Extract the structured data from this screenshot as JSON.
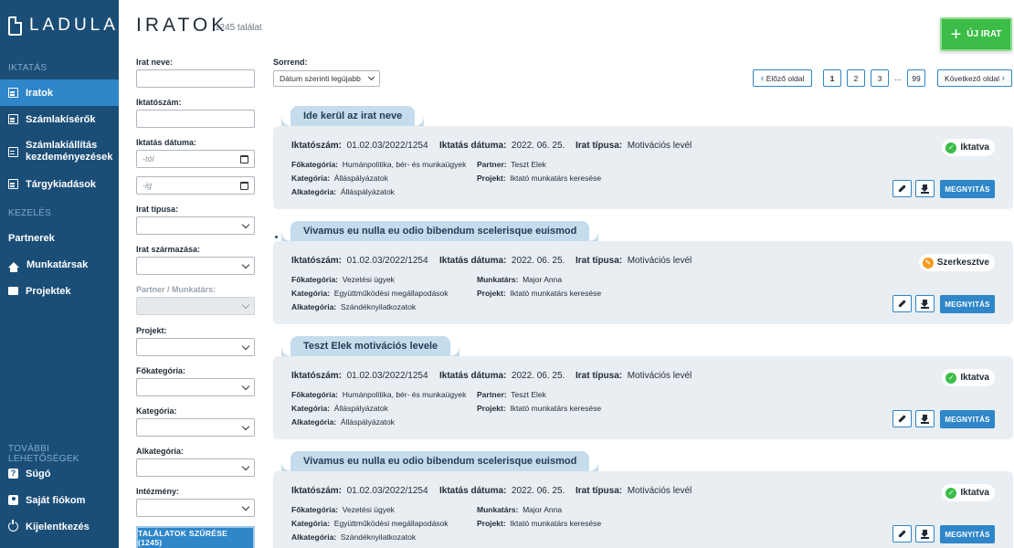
{
  "brand": {
    "logo": "LADULA"
  },
  "sidebar": {
    "sections": {
      "iktatas": "IKTATÁS",
      "kezeles": "KEZELÉS",
      "tovabbi": "TOVÁBBI LEHETŐSÉGEK"
    },
    "items": [
      {
        "label": "Iratok",
        "icon": "document-icon"
      },
      {
        "label": "Számlakísérők",
        "icon": "invoice-icon"
      },
      {
        "label": "Számlakiállítás kezdeményezések",
        "icon": "invoice-add-icon"
      },
      {
        "label": "Tárgykiadások",
        "icon": "item-out-icon"
      },
      {
        "label": "Partnerek",
        "icon": "contact-card-icon"
      },
      {
        "label": "Munkatársak",
        "icon": "home-icon"
      },
      {
        "label": "Projektek",
        "icon": "folder-icon"
      },
      {
        "label": "Súgó",
        "icon": "help-icon"
      },
      {
        "label": "Saját fiókom",
        "icon": "user-icon"
      },
      {
        "label": "Kijelentkezés",
        "icon": "power-icon"
      }
    ]
  },
  "header": {
    "title": "IRATOK",
    "count": "1245 találat",
    "new_button": "ÚJ IRAT"
  },
  "filters": {
    "name_label": "Irat neve:",
    "number_label": "Iktatószám:",
    "date_label": "Iktatás dátuma:",
    "date_from_placeholder": "-tól",
    "date_to_placeholder": "-ig",
    "type_label": "Irat típusa:",
    "origin_label": "Irat származása:",
    "partner_label": "Partner / Munkatárs:",
    "project_label": "Projekt:",
    "main_cat_label": "Főkategória:",
    "cat_label": "Kategória:",
    "sub_cat_label": "Alkategória:",
    "institution_label": "Intézmény:",
    "submit": "TALÁLATOK SZŰRÉSE (1245)"
  },
  "sort": {
    "label": "Sorrend:",
    "value": "Dátum szerinti legújabb"
  },
  "pagination": {
    "prev": "Előző oldal",
    "next": "Következő oldal",
    "pages": [
      "1",
      "2",
      "3",
      "99"
    ],
    "dots": "...",
    "current": "1"
  },
  "labels": {
    "number": "Iktatószám:",
    "date": "Iktatás dátuma:",
    "type": "Irat típusa:",
    "main_cat": "Főkategória:",
    "cat": "Kategória:",
    "sub_cat": "Alkategória:",
    "partner": "Partner:",
    "colleague": "Munkatárs:",
    "project": "Projekt:",
    "open": "MEGNYITÁS"
  },
  "documents": [
    {
      "title": "Ide kerül az irat neve",
      "number": "01.02.03/2022/1254",
      "date": "2022. 06. 25.",
      "type": "Motivációs levél",
      "main_cat": "Humánpolitika, bér- és munkaügyek",
      "cat": "Álláspályázatok",
      "sub_cat": "Álláspályázatok",
      "person_kind": "partner",
      "person": "Teszt Elek",
      "project": "Iktató munkatárs keresése",
      "status": "Iktatva",
      "status_color": "#3bbd48"
    },
    {
      "title": "Vivamus eu nulla eu odio bibendum scelerisque euismod",
      "number": "01.02.03/2022/1254",
      "date": "2022. 06. 25.",
      "type": "Motivációs levél",
      "main_cat": "Vezetési ügyek",
      "cat": "Együttműködési megállapodások",
      "sub_cat": "Szándéknyilatkozatok",
      "person_kind": "colleague",
      "person": "Major Anna",
      "project": "Iktató munkatárs keresése",
      "status": "Szerkesztve",
      "status_color": "#f39a1e"
    },
    {
      "title": "Teszt Elek motivációs levele",
      "number": "01.02.03/2022/1254",
      "date": "2022. 06. 25.",
      "type": "Motivációs levél",
      "main_cat": "Humánpolitika, bér- és munkaügyek",
      "cat": "Álláspályázatok",
      "sub_cat": "Álláspályázatok",
      "person_kind": "partner",
      "person": "Teszt Elek",
      "project": "Iktató munkatárs keresése",
      "status": "Iktatva",
      "status_color": "#3bbd48"
    },
    {
      "title": "Vivamus eu nulla eu odio bibendum scelerisque euismod",
      "number": "01.02.03/2022/1254",
      "date": "2022. 06. 25.",
      "type": "Motivációs levél",
      "main_cat": "Vezetési ügyek",
      "cat": "Együttműködési megállapodások",
      "sub_cat": "Szándéknyilatkozatok",
      "person_kind": "colleague",
      "person": "Major Anna",
      "project": "Iktató munkatárs keresése",
      "status": "Iktatva",
      "status_color": "#3bbd48"
    }
  ]
}
